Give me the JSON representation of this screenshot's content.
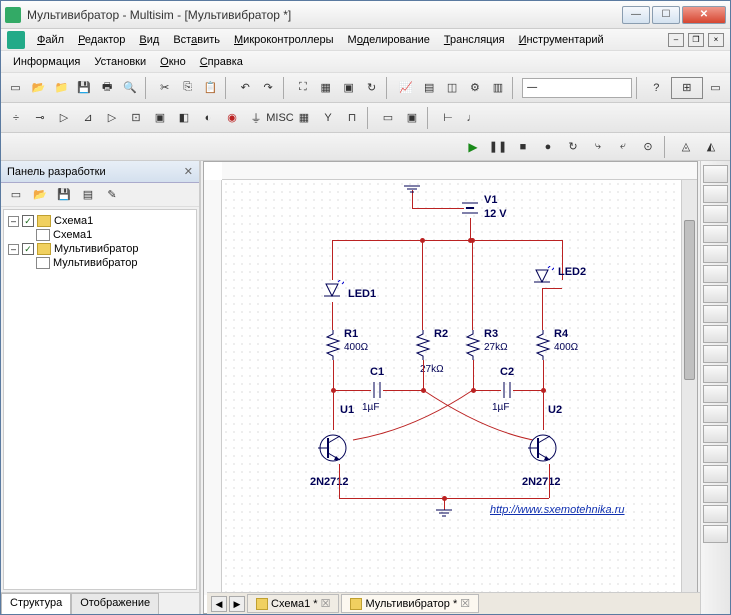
{
  "window": {
    "title": "Мультивибратор - Multisim - [Мультивибратор *]"
  },
  "menu": {
    "file": "Файл",
    "edit": "Редактор",
    "view": "Вид",
    "insert": "Вставить",
    "mcu": "Микроконтроллеры",
    "sim": "Моделирование",
    "trans": "Трансляция",
    "instr": "Инструментарий",
    "info": "Информация",
    "setup": "Установки",
    "window": "Окно",
    "help": "Справка"
  },
  "sidebar": {
    "header": "Панель разработки",
    "tree": {
      "n0": "Схема1",
      "n0c": "Схема1",
      "n1": "Мультивибратор",
      "n1c": "Мультивибратор"
    },
    "tabs": {
      "struct": "Структура",
      "view": "Отображение"
    }
  },
  "doctabs": {
    "t0": "Схема1 *",
    "t1": "Мультивибратор *"
  },
  "circuit": {
    "v1": "V1",
    "v1v": "12 V",
    "led1": "LED1",
    "led2": "LED2",
    "r1": "R1",
    "r1v": "400Ω",
    "r2": "R2",
    "r2v": "27kΩ",
    "r3": "R3",
    "r3v": "27kΩ",
    "r4": "R4",
    "r4v": "400Ω",
    "c1": "C1",
    "c1v": "1µF",
    "c2": "C2",
    "c2v": "1µF",
    "u1": "U1",
    "u2": "U2",
    "q1": "2N2712",
    "q2": "2N2712",
    "url": "http://www.sxemotehnika.ru"
  },
  "toolbar_select": "—"
}
